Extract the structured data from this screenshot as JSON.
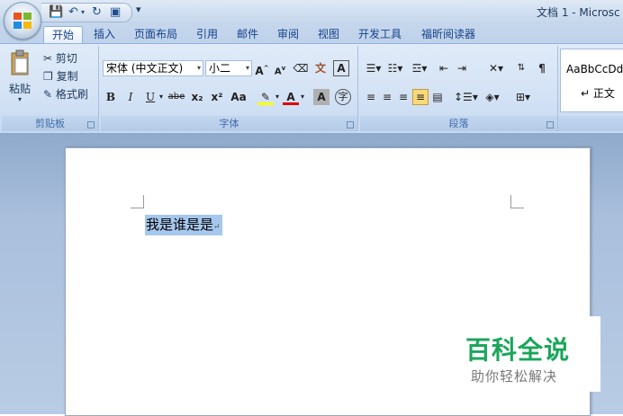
{
  "window": {
    "title": "文档 1 - Microsc"
  },
  "quick_access": {
    "more": "▾"
  },
  "tabs": [
    "开始",
    "插入",
    "页面布局",
    "引用",
    "邮件",
    "审阅",
    "视图",
    "开发工具",
    "福昕阅读器"
  ],
  "ribbon": {
    "clipboard": {
      "label": "剪贴板",
      "paste": "粘贴",
      "cut": "剪切",
      "copy": "复制",
      "format_painter": "格式刷"
    },
    "font": {
      "label": "字体",
      "font_name": "宋体 (中文正文)",
      "font_size": "小二",
      "bold": "B",
      "italic": "I",
      "underline": "U",
      "strike": "abe",
      "subscript": "x₂",
      "superscript": "x²",
      "change_case": "Aa",
      "grow": "A",
      "shrink": "A",
      "char_shading": "A",
      "char_border": "A",
      "enclose": "字"
    },
    "paragraph": {
      "label": "段落"
    },
    "styles": {
      "preview": "AaBbCcDd",
      "normal": "↵ 正文"
    }
  },
  "document": {
    "text": "我是谁是是",
    "para_mark": "↵"
  },
  "watermark": {
    "title": "百科全说",
    "subtitle": "助你轻松解决"
  },
  "colors": {
    "highlight": "#a6c7ee",
    "watermark_green": "#1ba65b",
    "ribbon_bg": "#d3e2f5"
  }
}
